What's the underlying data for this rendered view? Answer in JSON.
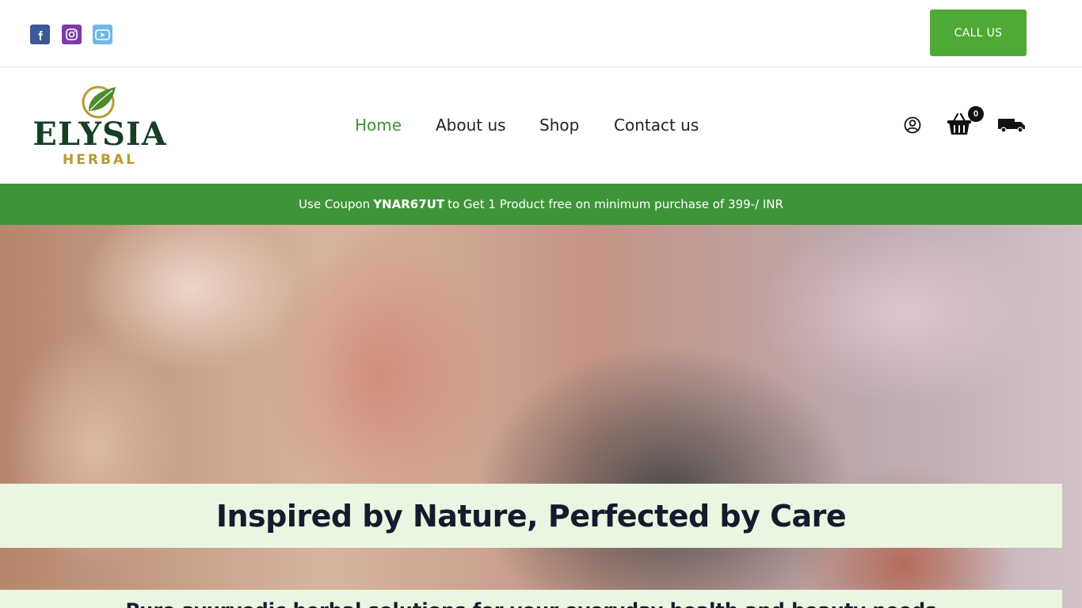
{
  "topbar": {
    "social": [
      {
        "icon": "facebook-icon",
        "color": "#3b5998"
      },
      {
        "icon": "instagram-icon",
        "color": "#7e3ba8"
      },
      {
        "icon": "youtube-icon",
        "color": "#6fb9e6"
      }
    ],
    "call_label": "CALL US"
  },
  "header": {
    "logo": {
      "word": "ELYSIA",
      "sub": "HERBAL"
    },
    "nav": [
      {
        "label": "Home",
        "active": true
      },
      {
        "label": "About us"
      },
      {
        "label": "Shop"
      },
      {
        "label": "Contact us"
      }
    ],
    "cart_count": "0"
  },
  "promo": {
    "before": "Use Coupon",
    "code": "YNAR67UT",
    "after": "to Get 1 Product free on minimum purchase of 399-/ INR"
  },
  "hero": {
    "headline": "Inspired by Nature, Perfected by Care",
    "subheadline": "Pure ayurvedic herbal solutions for your everyday health and beauty needs"
  },
  "colors": {
    "brand_green": "#3f9539",
    "button_green": "#4eaa35",
    "logo_green": "#163f24",
    "logo_gold": "#b79a2f",
    "band_bg": "#eaf6e1"
  }
}
